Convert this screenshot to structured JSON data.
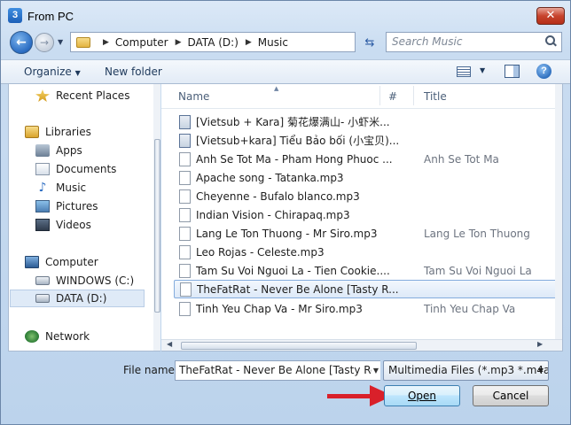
{
  "window": {
    "title": "From PC",
    "icon_text": "3"
  },
  "address": {
    "crumbs": [
      "Computer",
      "DATA (D:)",
      "Music"
    ],
    "search_placeholder": "Search Music"
  },
  "toolbar": {
    "organize": "Organize",
    "new_folder": "New folder",
    "help": "?"
  },
  "nav": {
    "items": [
      {
        "label": "Recent Places",
        "icon": "recent-places-icon"
      },
      {
        "label": "Libraries",
        "icon": "libraries-icon"
      },
      {
        "label": "Apps",
        "icon": "apps-icon"
      },
      {
        "label": "Documents",
        "icon": "documents-icon"
      },
      {
        "label": "Music",
        "icon": "music-icon"
      },
      {
        "label": "Pictures",
        "icon": "pictures-icon"
      },
      {
        "label": "Videos",
        "icon": "videos-icon"
      },
      {
        "label": "Computer",
        "icon": "computer-icon"
      },
      {
        "label": "WINDOWS (C:)",
        "icon": "drive-icon"
      },
      {
        "label": "DATA (D:)",
        "icon": "drive-icon"
      },
      {
        "label": "Network",
        "icon": "network-icon"
      }
    ]
  },
  "columns": {
    "name": "Name",
    "number": "#",
    "title": "Title"
  },
  "files": [
    {
      "name": "[Vietsub + Kara] 菊花爆满山- 小虾米...",
      "title": ""
    },
    {
      "name": "[Vietsub+kara] Tiểu Bảo bối (小宝贝)...",
      "title": ""
    },
    {
      "name": "Anh Se Tot Ma - Pham Hong Phuoc ...",
      "title": "Anh Se Tot Ma"
    },
    {
      "name": "Apache song - Tatanka.mp3",
      "title": ""
    },
    {
      "name": "Cheyenne - Bufalo blanco.mp3",
      "title": ""
    },
    {
      "name": "Indian Vision - Chirapaq.mp3",
      "title": ""
    },
    {
      "name": "Lang Le Ton Thuong - Mr Siro.mp3",
      "title": "Lang Le Ton Thuong"
    },
    {
      "name": "Leo Rojas - Celeste.mp3",
      "title": ""
    },
    {
      "name": "Tam Su Voi Nguoi La - Tien Cookie....",
      "title": "Tam Su Voi Nguoi La"
    },
    {
      "name": "TheFatRat - Never Be Alone [Tasty R...",
      "title": ""
    },
    {
      "name": "Tinh Yeu Chap Va - Mr Siro.mp3",
      "title": "Tinh Yeu Chap Va"
    }
  ],
  "selected_file_index": 9,
  "bottom": {
    "file_name_label": "File name:",
    "file_name_value": "TheFatRat - Never Be Alone [Tasty Rel",
    "file_type_value": "Multimedia Files (*.mp3 *.m4a",
    "open_label": "Open",
    "cancel_label": "Cancel"
  },
  "colors": {
    "annotation_arrow": "#d9202a",
    "selection": "#dde9f8"
  }
}
